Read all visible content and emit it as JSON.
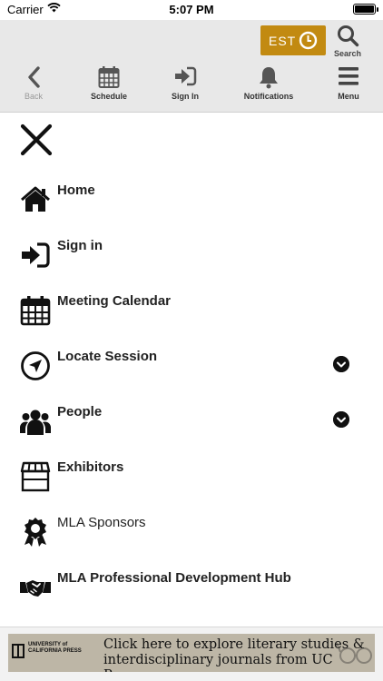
{
  "status_bar": {
    "carrier": "Carrier",
    "time": "5:07 PM"
  },
  "header": {
    "timezone_button": "EST",
    "search_label": "Search",
    "nav": [
      {
        "label": "Back",
        "icon": "chevron-left-icon"
      },
      {
        "label": "Schedule",
        "icon": "calendar-icon"
      },
      {
        "label": "Sign In",
        "icon": "sign-in-icon"
      },
      {
        "label": "Notifications",
        "icon": "bell-icon"
      },
      {
        "label": "Menu",
        "icon": "hamburger-icon"
      }
    ],
    "colors": {
      "background": "#e8e8e8",
      "timezone_button": "#c28a11"
    }
  },
  "menu": {
    "close_icon": "close-icon",
    "items": [
      {
        "label": "Home",
        "icon": "home-icon",
        "expandable": false
      },
      {
        "label": "Sign in",
        "icon": "sign-in-icon",
        "expandable": false
      },
      {
        "label": "Meeting Calendar",
        "icon": "calendar-icon",
        "expandable": false
      },
      {
        "label": "Locate Session",
        "icon": "location-arrow-icon",
        "expandable": true
      },
      {
        "label": "People",
        "icon": "people-icon",
        "expandable": true
      },
      {
        "label": "Exhibitors",
        "icon": "storefront-icon",
        "expandable": false
      },
      {
        "label": "MLA Sponsors",
        "icon": "award-ribbon-icon",
        "expandable": false
      },
      {
        "label": "MLA Professional Development Hub",
        "icon": "handshake-icon",
        "expandable": false
      }
    ]
  },
  "ad": {
    "publisher": "UNIVERSITY of CALIFORNIA PRESS",
    "text": "Click here to explore literary studies & interdisciplinary journals from UC Press"
  }
}
